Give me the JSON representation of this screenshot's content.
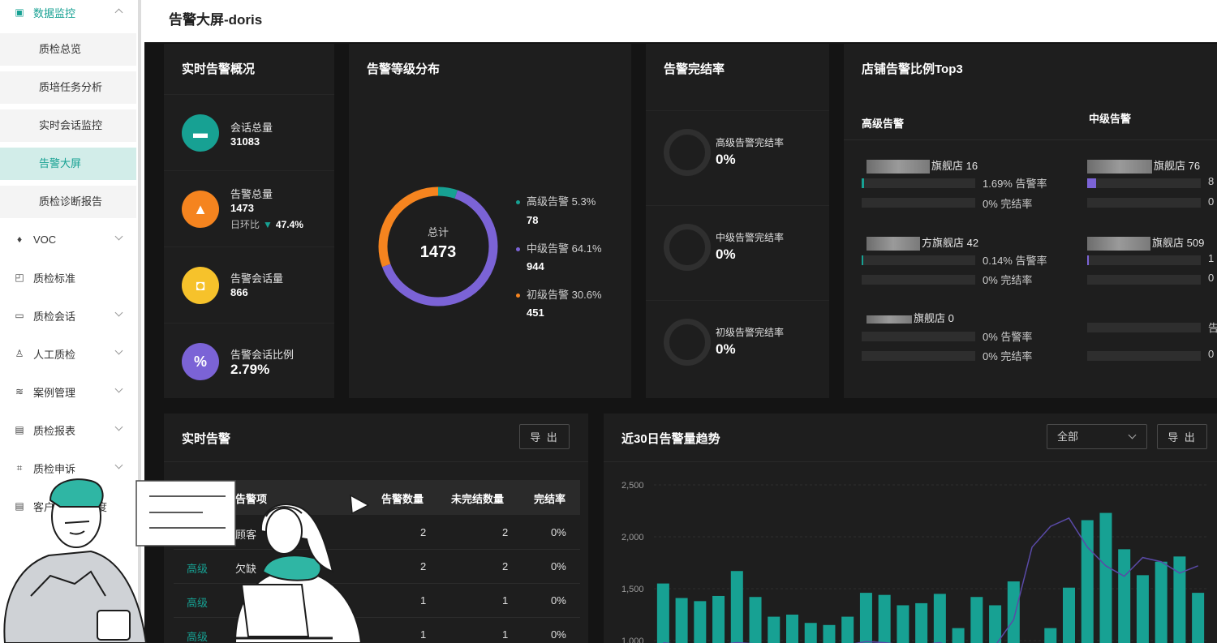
{
  "sidebar": {
    "groups": [
      {
        "label": "数据监控",
        "icon": "monitor-icon",
        "expanded": true
      },
      {
        "label": "VOC",
        "icon": "diamond-icon"
      },
      {
        "label": "质检标准",
        "icon": "standard-doc-icon"
      },
      {
        "label": "质检会话",
        "icon": "chat-icon"
      },
      {
        "label": "人工质检",
        "icon": "user-icon"
      },
      {
        "label": "案例管理",
        "icon": "layers-icon"
      },
      {
        "label": "质检报表",
        "icon": "report-icon"
      },
      {
        "label": "质检申诉",
        "icon": "appeal-icon"
      },
      {
        "label": "客户评价满意度",
        "icon": "rating-icon"
      }
    ],
    "sub_items": [
      "质检总览",
      "质培任务分析",
      "实时会话监控",
      "告警大屏",
      "质检诊断报告"
    ],
    "active_sub": "告警大屏"
  },
  "header": {
    "title": "告警大屏-doris"
  },
  "overview": {
    "title": "实时告警概况",
    "items": [
      {
        "label": "会话总量",
        "value": "31083",
        "color": "#17a193",
        "icon": "chat-bubble-icon"
      },
      {
        "label": "告警总量",
        "value": "1473",
        "color": "#f5841f",
        "icon": "alarm-icon",
        "sub_label": "日环比",
        "sub_arrow": "▼",
        "sub_value": "47.4%"
      },
      {
        "label": "告警会话量",
        "value": "866",
        "color": "#f6c22b",
        "icon": "message-icon"
      },
      {
        "label": "告警会话比例",
        "value": "2.79%",
        "color": "#7b63d6",
        "icon": "percent-icon"
      }
    ]
  },
  "distribution": {
    "title": "告警等级分布",
    "center_label": "总计",
    "center_value": "1473",
    "slices": [
      {
        "name": "高级告警",
        "percent": "5.3%",
        "value": 78,
        "color": "#17a193"
      },
      {
        "name": "中级告警",
        "percent": "64.1%",
        "value": 944,
        "color": "#7b63d6"
      },
      {
        "name": "初级告警",
        "percent": "30.6%",
        "value": 451,
        "color": "#f5841f"
      }
    ]
  },
  "completion": {
    "title": "告警完结率",
    "items": [
      {
        "label": "高级告警完结率",
        "value": "0%"
      },
      {
        "label": "中级告警完结率",
        "value": "0%"
      },
      {
        "label": "初级告警完结率",
        "value": "0%"
      }
    ]
  },
  "top3": {
    "title": "店铺告警比例Top3",
    "columns": [
      {
        "title": "高级告警",
        "color": "#17a193",
        "stores": [
          {
            "name": "旗舰店 16",
            "alert_rate": "1.69% 告警率",
            "done_rate": "0% 完结率",
            "fill": 0.02
          },
          {
            "name": "方旗舰店 42",
            "alert_rate": "0.14% 告警率",
            "done_rate": "0% 完结率",
            "fill": 0.01
          },
          {
            "name": "旗舰店 0",
            "alert_rate": "0% 告警率",
            "done_rate": "0% 完结率",
            "fill": 0
          }
        ]
      },
      {
        "title": "中级告警",
        "color": "#7b63d6",
        "stores": [
          {
            "name": "旗舰店 76",
            "alert_rate": "8",
            "done_rate": "0",
            "fill": 0.08
          },
          {
            "name": "旗舰店 509",
            "alert_rate": "1",
            "done_rate": "0",
            "fill": 0.01
          },
          {
            "name": "",
            "alert_rate": "告",
            "done_rate": "0",
            "fill": 0
          }
        ]
      }
    ]
  },
  "realtime": {
    "title": "实时告警",
    "export_label": "导 出",
    "columns": [
      "告警项",
      "告警数量",
      "未完结数量",
      "完结率"
    ],
    "rows": [
      {
        "level": "",
        "item": "顾客",
        "count": "2",
        "open": "2",
        "rate": "0%"
      },
      {
        "level": "高级",
        "item": "欠缺",
        "count": "2",
        "open": "2",
        "rate": "0%"
      },
      {
        "level": "高级",
        "item": "",
        "count": "1",
        "open": "1",
        "rate": "0%"
      },
      {
        "level": "高级",
        "item": "",
        "count": "1",
        "open": "1",
        "rate": "0%"
      }
    ]
  },
  "trend": {
    "title": "近30日告警量趋势",
    "select_value": "全部",
    "export_label": "导 出"
  },
  "chart_data": {
    "type": "bar",
    "yticks": [
      "2,500",
      "2,000",
      "1,500",
      "1,000"
    ],
    "ylim": [
      1000,
      2500
    ],
    "bar_color": "#17a193",
    "line_color": "#5a4aa8",
    "series": [
      {
        "values": [
          1550,
          1410,
          1380,
          1430,
          1670,
          1420,
          1230,
          1250,
          1170,
          1150,
          1230,
          1460,
          1440,
          1340,
          1360,
          1450,
          1120,
          1420,
          1340,
          1570,
          950,
          1120,
          1510,
          2160,
          2230,
          1880,
          1630,
          1760,
          1810,
          1460
        ]
      },
      {
        "values": [
          980,
          960,
          950,
          960,
          980,
          970,
          950,
          950,
          940,
          940,
          960,
          990,
          980,
          960,
          960,
          980,
          920,
          960,
          950,
          1200,
          1900,
          2100,
          2180,
          1900,
          1720,
          1620,
          1800,
          1760,
          1650,
          1720
        ]
      }
    ]
  }
}
